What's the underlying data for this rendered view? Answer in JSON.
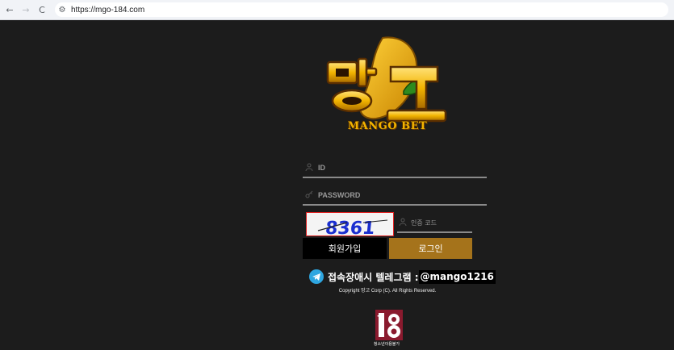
{
  "browser": {
    "url": "https://mgo-184.com",
    "back_icon": "←",
    "forward_icon": "→",
    "reload_icon": "C",
    "site_info_icon": "⚙"
  },
  "logo": {
    "brand_text": "MANGO BET"
  },
  "form": {
    "id_placeholder": "ID",
    "password_placeholder": "PASSWORD",
    "captcha_value": "8361",
    "code_placeholder": "인증 코드",
    "signup_label": "회원가입",
    "login_label": "로그인"
  },
  "footer": {
    "telegram_text": "접속장애시 텔레그램 :",
    "telegram_handle": "@mango1216",
    "copyright": "Copyright 망고 Corp (C). All Rights Reserved.",
    "age_label": "청소년이용불가"
  },
  "colors": {
    "background": "#1c1c1c",
    "login_button": "#a5731b",
    "signup_button": "#000000",
    "telegram": "#2ea6e0",
    "brand_gold": "#f2b400"
  }
}
